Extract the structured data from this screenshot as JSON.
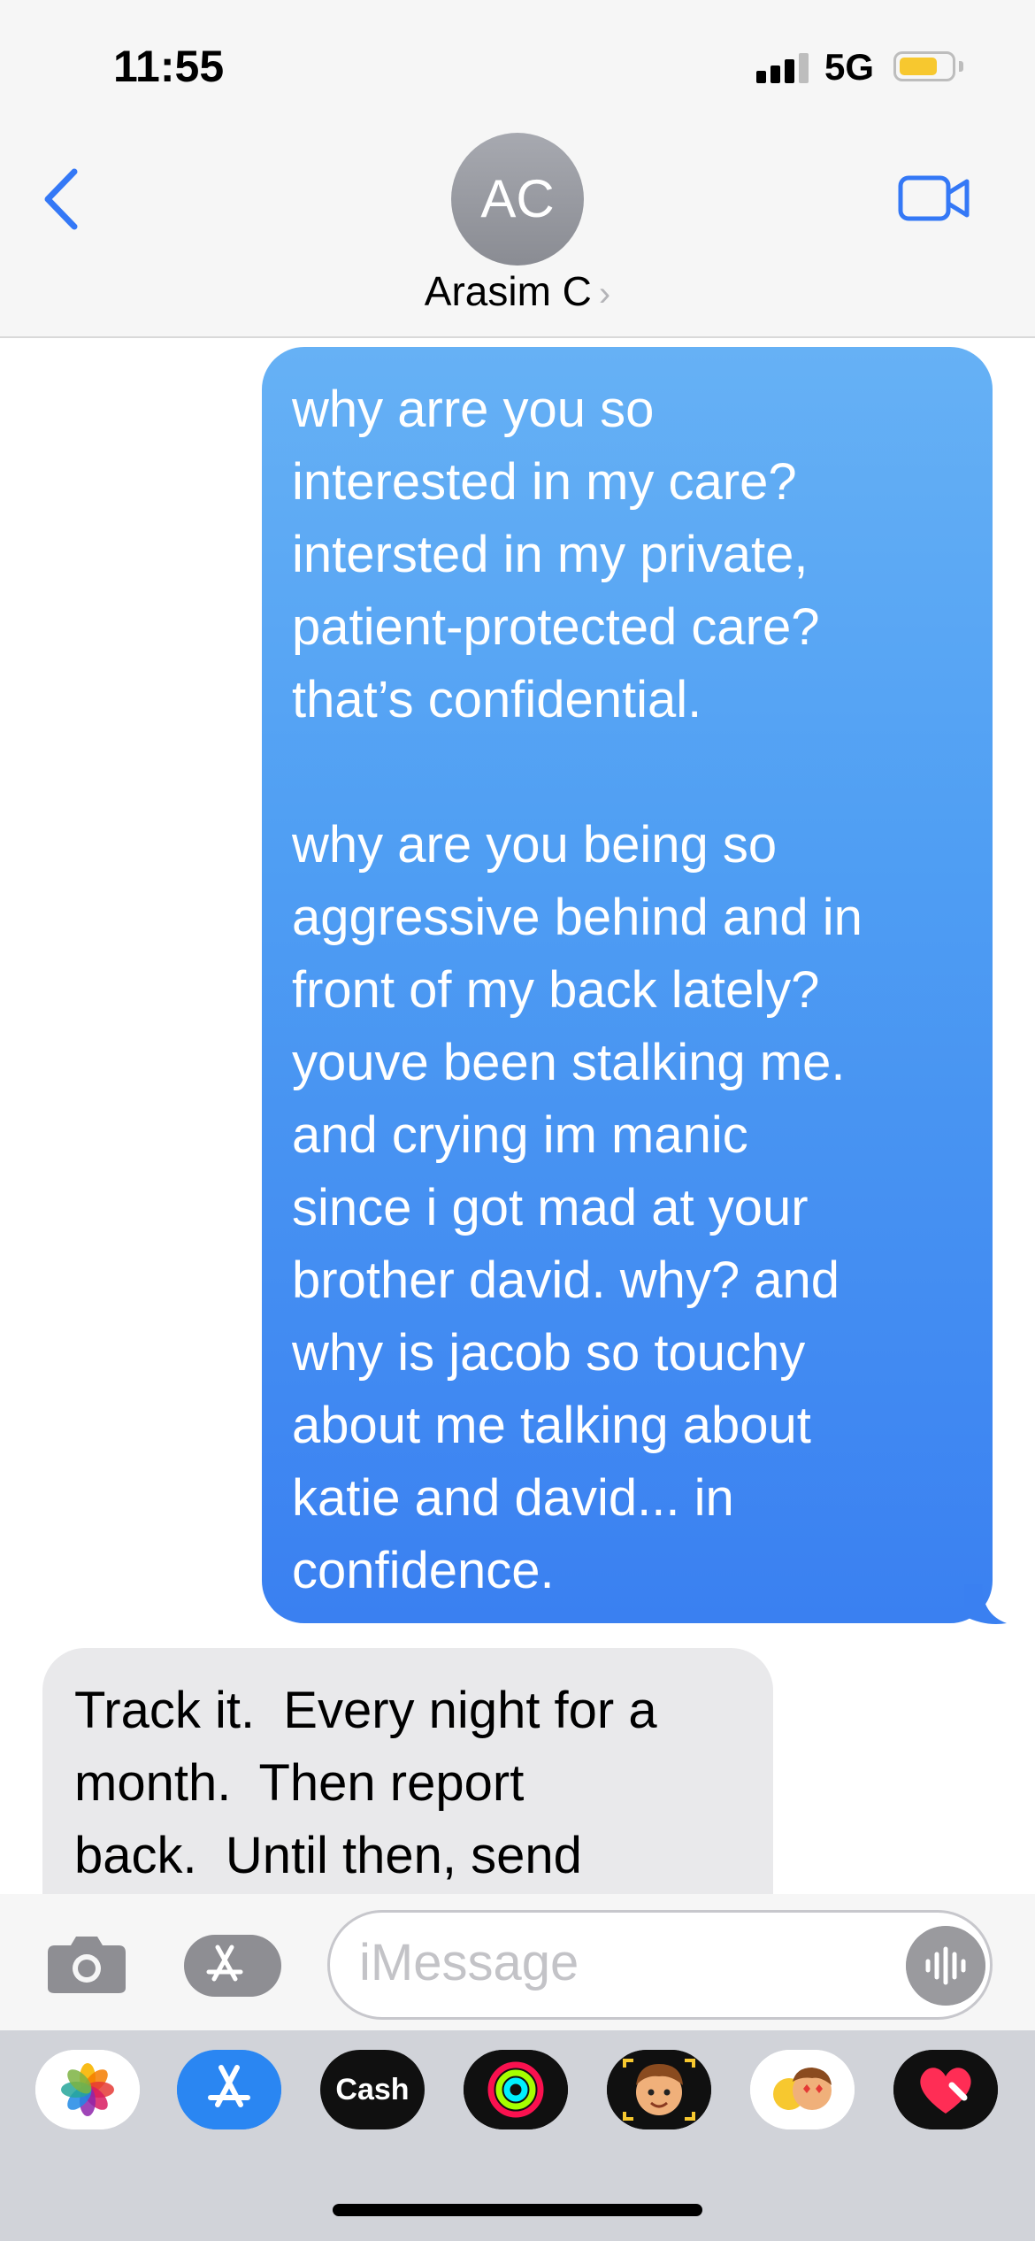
{
  "status_bar": {
    "time": "11:55",
    "network": "5G",
    "battery_color": "#f7c82f"
  },
  "header": {
    "avatar_initials": "AC",
    "contact_name": "Arasim C",
    "contact_chevron": "›",
    "back_icon": "chevron-left-icon",
    "video_icon": "video-camera-icon",
    "accent": "#3478f6"
  },
  "messages": [
    {
      "direction": "outgoing",
      "text": "why arre you so\ninterested in my care?\nintersted in my private,\npatient-protected care?\nthat’s confidential.\n\nwhy are you being so\naggressive behind and in\nfront of my back lately?\nyouve been stalking me.\nand crying im manic\nsince i got mad at your\nbrother david. why? and\nwhy is jacob so touchy\nabout me talking about\nkatie and david... in\nconfidence."
    },
    {
      "direction": "incoming",
      "text": "Track it.  Every night for a\nmonth.  Then report\nback.  Until then, send"
    }
  ],
  "input": {
    "placeholder": "iMessage",
    "camera_icon": "camera-icon",
    "apps_icon": "app-store-icon",
    "audio_icon": "audio-waveform-icon"
  },
  "app_drawer": {
    "items": [
      {
        "name": "Photos",
        "icon": "photos-icon"
      },
      {
        "name": "App Store",
        "icon": "app-store-icon"
      },
      {
        "name": "Cash",
        "label": "Cash",
        "icon": "apple-cash-icon"
      },
      {
        "name": "Fitness",
        "icon": "activity-rings-icon"
      },
      {
        "name": "Memoji",
        "icon": "memoji-icon"
      },
      {
        "name": "Memoji Stickers",
        "icon": "memoji-stickers-icon"
      },
      {
        "name": "Digital Touch",
        "icon": "digital-touch-heart-icon"
      }
    ]
  }
}
